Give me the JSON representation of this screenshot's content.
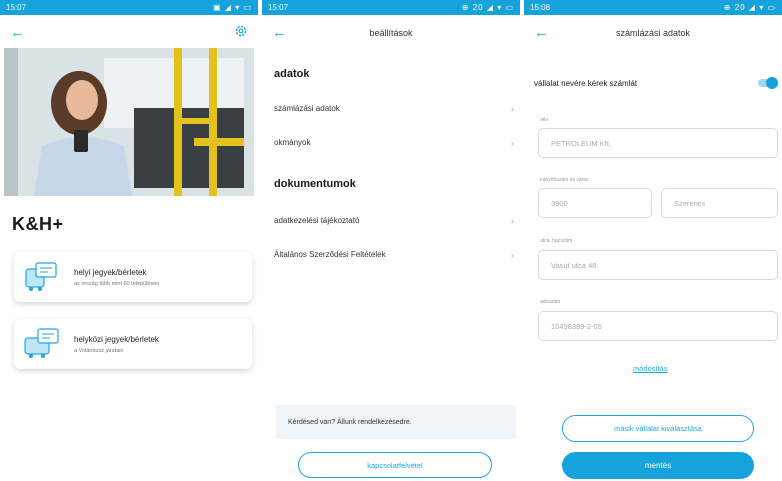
{
  "screen1": {
    "status": {
      "time": "15:07",
      "right": "▣ ◢ ▾ ▭"
    },
    "brand": "K&H+",
    "cards": [
      {
        "title": "helyi jegyek/bérletek",
        "subtitle": "az ország több mint 60 településén"
      },
      {
        "title": "helyközi jegyek/bérletek",
        "subtitle": "a Volánbusz járatain"
      }
    ]
  },
  "screen2": {
    "status": {
      "time": "15:07",
      "right": "⊕ 20 ◢ ▾ ▭"
    },
    "title": "beállítások",
    "section_data": "adatok",
    "rows_data": [
      "számlázási adatok",
      "okmányok"
    ],
    "section_docs": "dokumentumok",
    "rows_docs": [
      "adatkezelési tájékoztató",
      "Általános Szerződési Feltételek"
    ],
    "banner": "Kérdésed van? Állunk rendelkezésedre.",
    "contact_button": "kapcsolatfelvétel"
  },
  "screen3": {
    "status": {
      "time": "15:08",
      "right": "⊕ 20 ◢ ▾ ▭"
    },
    "title": "számlázási adatok",
    "toggle_label": "vállalat nevére kérek számlát",
    "fields": {
      "name_label": "név",
      "name_value": "PETROLEUM Kft.",
      "zip_city_label": "irányítószám és város",
      "zip_value": "3900",
      "city_value": "Szerencs",
      "street_label": "utca, házszám",
      "street_value": "Vasút utca 48",
      "tax_label": "adószám",
      "tax_value": "10498389-2-05"
    },
    "delete_link": "módosítás",
    "secondary_button": "másik vállalat kiválasztása",
    "primary_button": "mentés"
  }
}
